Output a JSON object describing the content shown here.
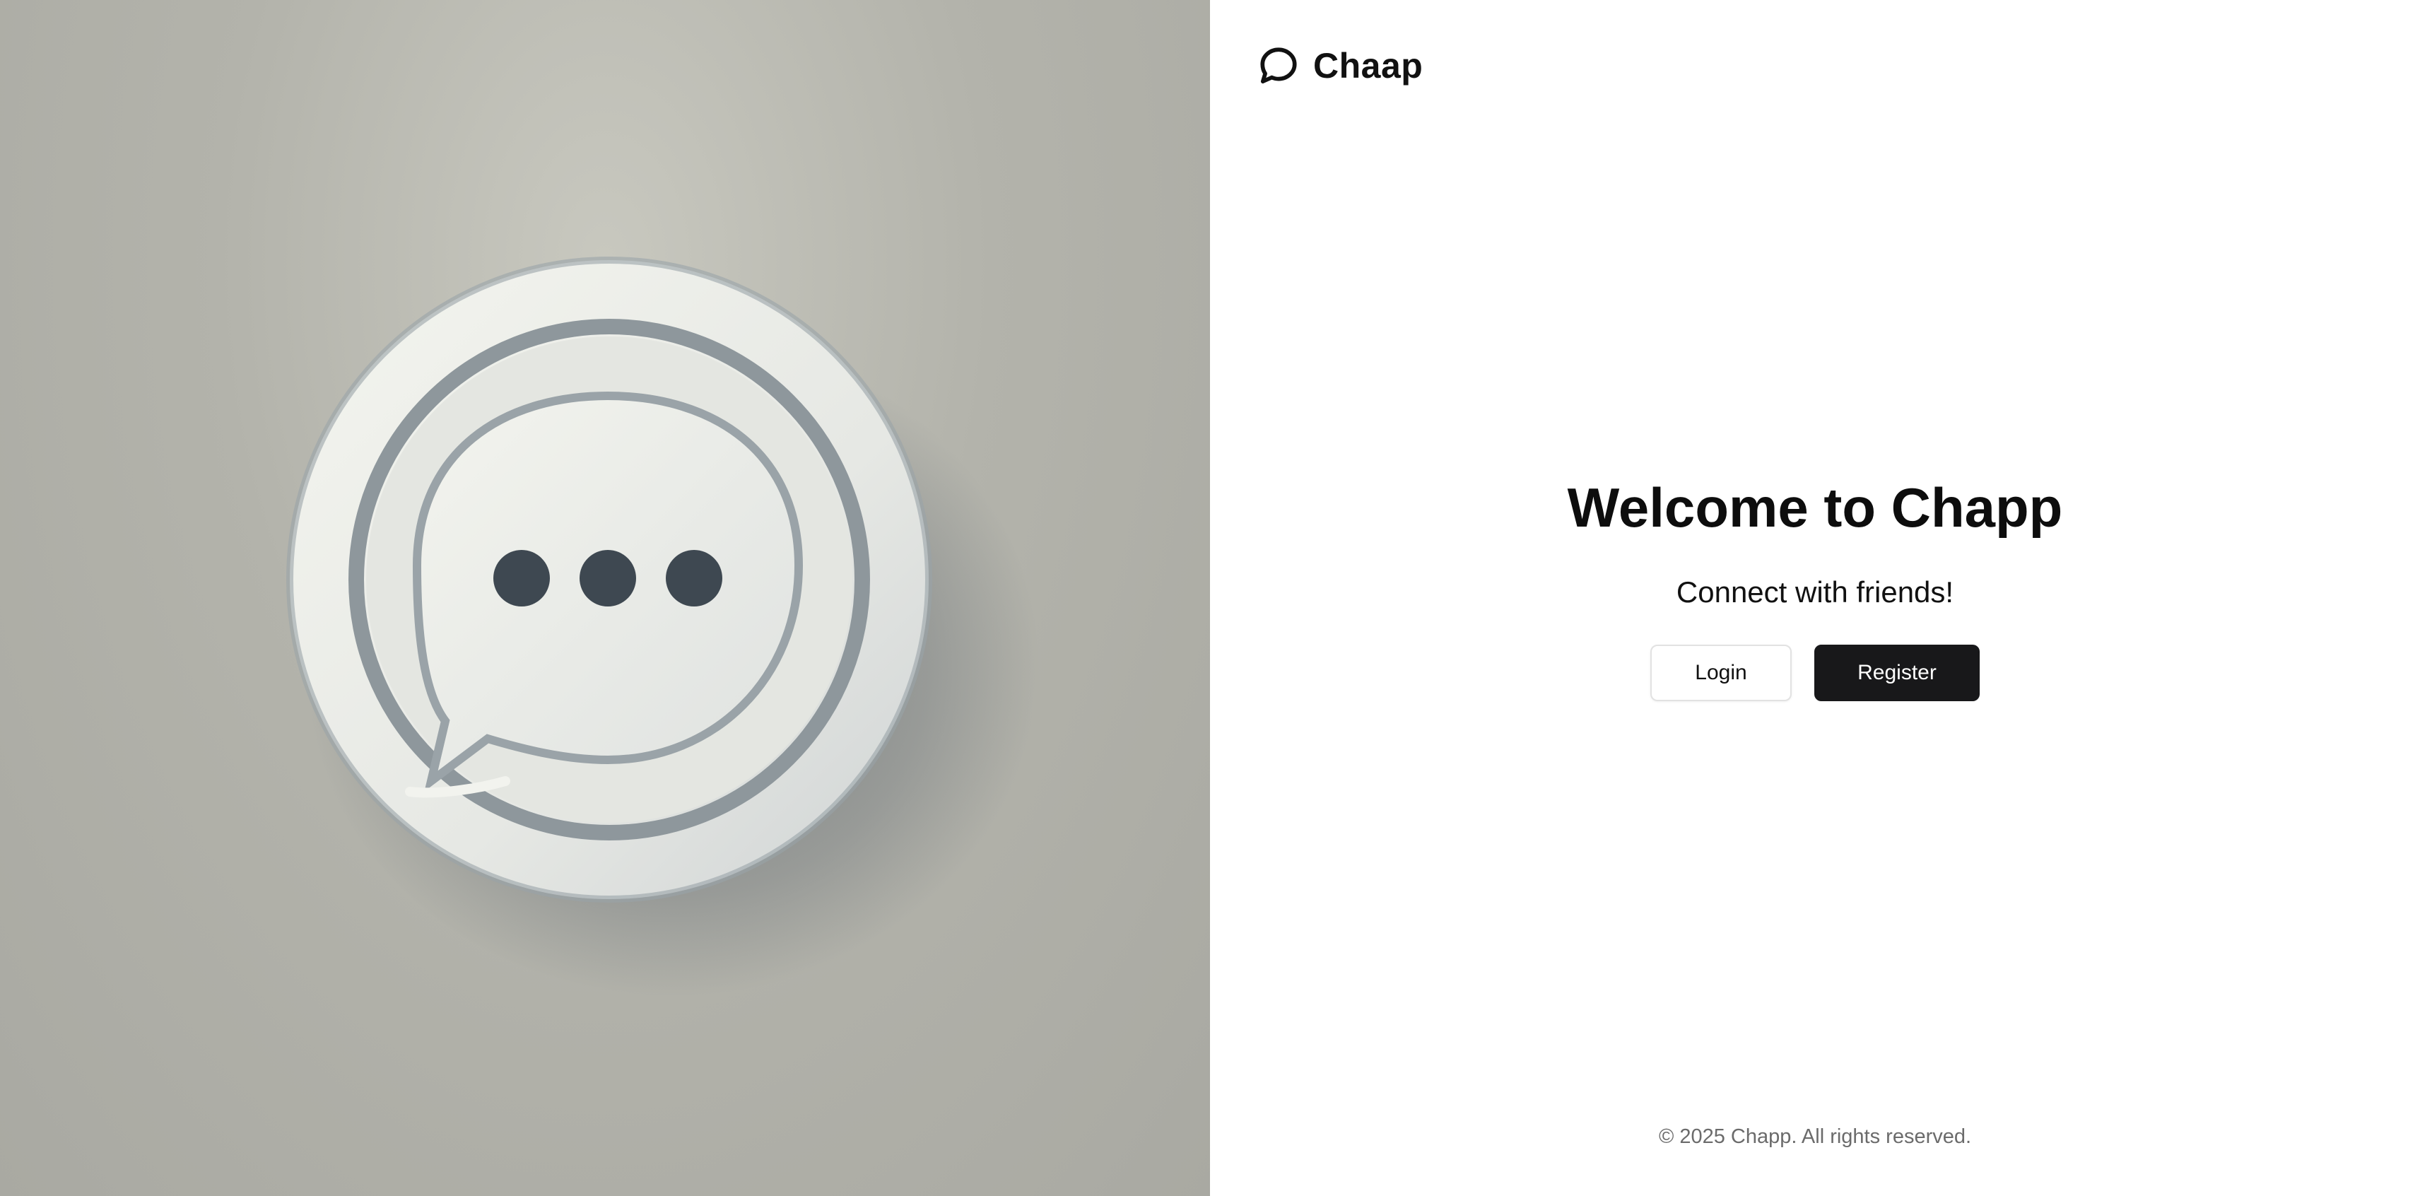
{
  "hero": {
    "image_description_icon": "chat-bubble-logo-icon"
  },
  "brand": {
    "icon": "chat-bubble-icon",
    "name": "Chaap"
  },
  "main": {
    "title": "Welcome to Chapp",
    "subtitle": "Connect with friends!",
    "login_label": "Login",
    "register_label": "Register"
  },
  "footer": {
    "text": "© 2025 Chapp. All rights reserved."
  },
  "colors": {
    "primary_button": "#18181a",
    "hero_background": "#b3b3ab",
    "footer_text": "#6b6b6b"
  }
}
